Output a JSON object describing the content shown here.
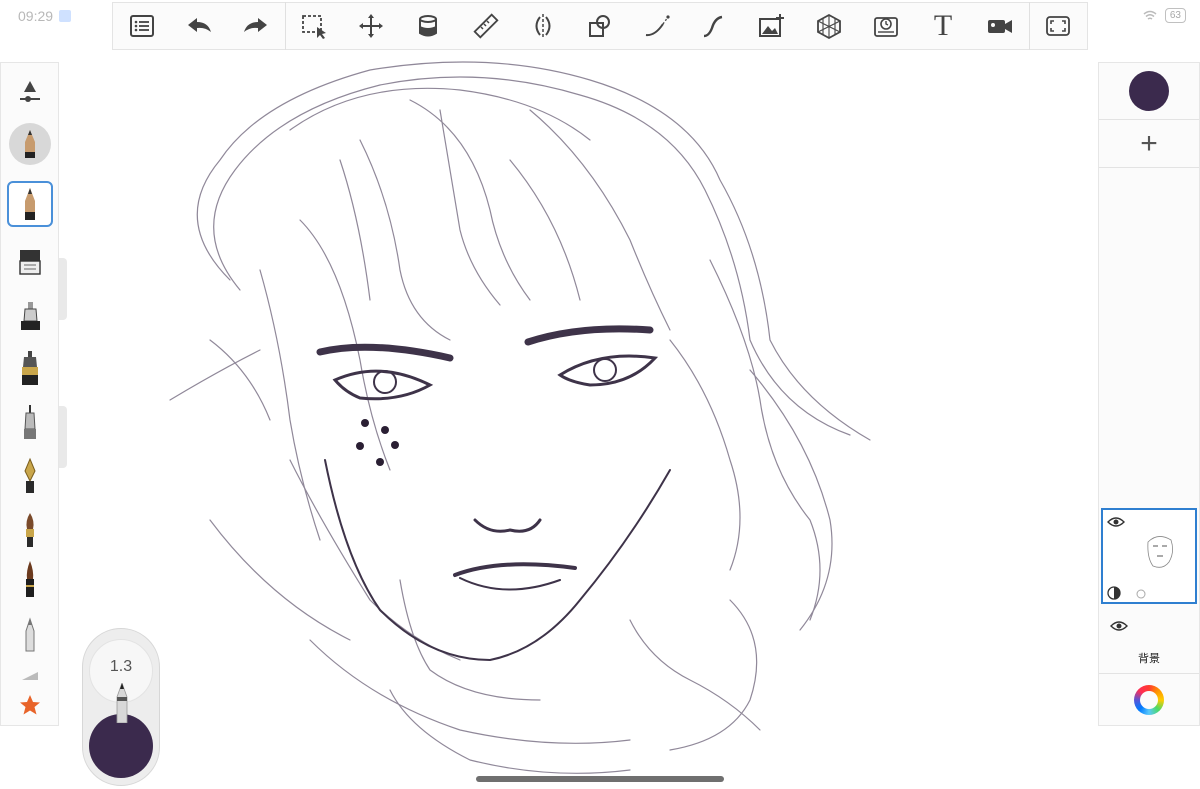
{
  "status_bar": {
    "time": "09:29",
    "battery": "63"
  },
  "toolbar": {
    "items": [
      {
        "name": "layers-list",
        "icon": "list-icon"
      },
      {
        "name": "undo",
        "icon": "undo-icon"
      },
      {
        "name": "redo",
        "icon": "redo-icon"
      },
      {
        "name": "selection",
        "icon": "selection-icon"
      },
      {
        "name": "transform",
        "icon": "move-icon"
      },
      {
        "name": "fill",
        "icon": "fill-bucket-icon"
      },
      {
        "name": "ruler",
        "icon": "ruler-icon"
      },
      {
        "name": "symmetry",
        "icon": "symmetry-icon"
      },
      {
        "name": "shapes",
        "icon": "shapes-icon"
      },
      {
        "name": "curve",
        "icon": "curve-icon"
      },
      {
        "name": "stroke",
        "icon": "stroke-icon"
      },
      {
        "name": "import-image",
        "icon": "image-add-icon"
      },
      {
        "name": "perspective",
        "icon": "perspective-grid-icon"
      },
      {
        "name": "time-lapse",
        "icon": "timelapse-icon"
      },
      {
        "name": "text",
        "icon": "text-icon",
        "label": "T"
      },
      {
        "name": "record",
        "icon": "video-icon"
      },
      {
        "name": "fullscreen",
        "icon": "fullscreen-icon"
      }
    ]
  },
  "left_tools": [
    {
      "name": "brush-settings",
      "icon": "slider-icon"
    },
    {
      "name": "pencil-preview",
      "icon": "pencil-icon"
    },
    {
      "name": "pencil",
      "icon": "pencil-icon",
      "selected": true
    },
    {
      "name": "eraser",
      "icon": "eraser-icon"
    },
    {
      "name": "marker",
      "icon": "marker-icon"
    },
    {
      "name": "ink-pen",
      "icon": "ink-pen-icon"
    },
    {
      "name": "technical-pen",
      "icon": "technical-pen-icon"
    },
    {
      "name": "fountain-pen",
      "icon": "fountain-pen-icon"
    },
    {
      "name": "paintbrush",
      "icon": "paintbrush-icon"
    },
    {
      "name": "airbrush",
      "icon": "airbrush-icon"
    },
    {
      "name": "chalk",
      "icon": "chalk-icon"
    },
    {
      "name": "favorites",
      "icon": "star-icon"
    }
  ],
  "brush": {
    "size": "1.3",
    "color": "#3b2a4d"
  },
  "right_panel": {
    "current_color": "#3b2a4d",
    "add_layer_label": "+",
    "layers": [
      {
        "name": "",
        "visible": true,
        "active": true
      },
      {
        "name": "背景",
        "visible": true,
        "active": false
      }
    ]
  },
  "colors": {
    "accent": "#2f7fd0",
    "sketch": "#5a5066"
  }
}
